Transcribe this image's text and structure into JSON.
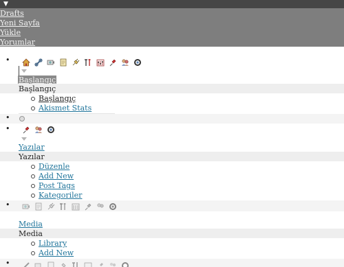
{
  "header": {
    "toggle_glyph": "▼"
  },
  "quick_links": [
    "Drafts",
    "Yeni Sayfa",
    "Yükle",
    "Yorumlar"
  ],
  "toolbar_icons": [
    "home-icon",
    "link-icon",
    "media-icon",
    "page-icon",
    "plugin-icon",
    "tools-icon",
    "settings-icon",
    "pin-icon",
    "users-icon",
    "bubble-icon"
  ],
  "dashboard": {
    "link": "Başlangıç",
    "heading": "Başlangıç",
    "items": [
      "Başlangıç",
      "Akismet Stats"
    ]
  },
  "posts": {
    "link": "Yazılar",
    "heading": "Yazılar",
    "items": [
      "Düzenle",
      "Add New",
      "Post Tags",
      "Kategoriler"
    ]
  },
  "media": {
    "link": "Media",
    "heading": "Media",
    "items": [
      "Library",
      "Add New"
    ]
  },
  "colors": {
    "link": "#21759b",
    "panel": "#7e7e7e",
    "topbar": "#464646",
    "stripe": "#eeeeee"
  }
}
